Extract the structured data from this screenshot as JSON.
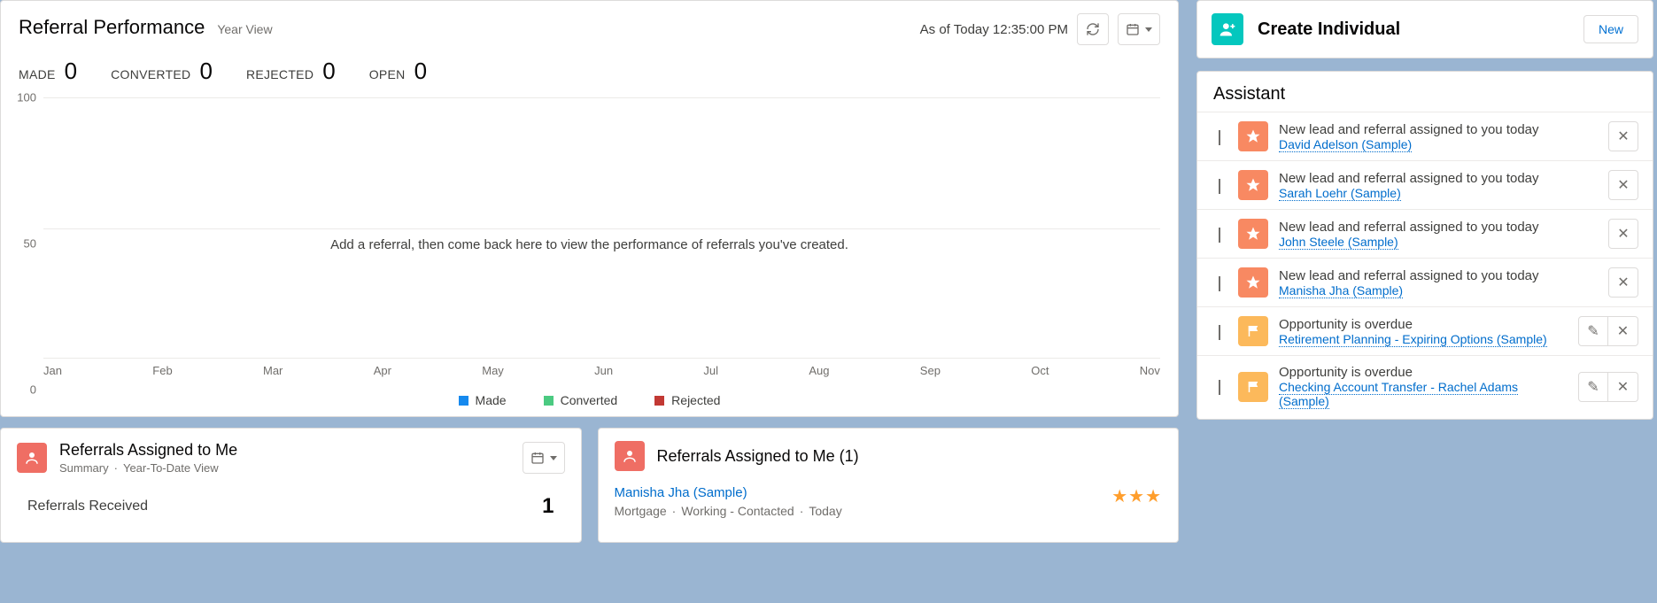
{
  "perf": {
    "title": "Referral Performance",
    "subtitle": "Year View",
    "asof": "As of Today 12:35:00 PM",
    "stats": [
      {
        "label": "MADE",
        "value": "0"
      },
      {
        "label": "CONVERTED",
        "value": "0"
      },
      {
        "label": "REJECTED",
        "value": "0"
      },
      {
        "label": "OPEN",
        "value": "0"
      }
    ],
    "message": "Add a referral, then come back here to view the performance of referrals you've created.",
    "legend": [
      {
        "label": "Made",
        "color": "#1589ee"
      },
      {
        "label": "Converted",
        "color": "#4bca81"
      },
      {
        "label": "Rejected",
        "color": "#c23934"
      }
    ]
  },
  "chart_data": {
    "type": "bar",
    "categories": [
      "Jan",
      "Feb",
      "Mar",
      "Apr",
      "May",
      "Jun",
      "Jul",
      "Aug",
      "Sep",
      "Oct",
      "Nov"
    ],
    "series": [
      {
        "name": "Made",
        "values": [
          0,
          0,
          0,
          0,
          0,
          0,
          0,
          0,
          0,
          0,
          0
        ]
      },
      {
        "name": "Converted",
        "values": [
          0,
          0,
          0,
          0,
          0,
          0,
          0,
          0,
          0,
          0,
          0
        ]
      },
      {
        "name": "Rejected",
        "values": [
          0,
          0,
          0,
          0,
          0,
          0,
          0,
          0,
          0,
          0,
          0
        ]
      }
    ],
    "ylim": [
      0,
      100
    ],
    "yticks": [
      0,
      50,
      100
    ],
    "title": "Referral Performance",
    "xlabel": "",
    "ylabel": ""
  },
  "summary_card": {
    "title": "Referrals Assigned to Me",
    "subtitle_a": "Summary",
    "subtitle_b": "Year-To-Date View",
    "row_label": "Referrals Received",
    "row_value": "1"
  },
  "list_card": {
    "title": "Referrals Assigned to Me (1)",
    "item": {
      "name": "Manisha Jha (Sample)",
      "f1": "Mortgage",
      "f2": "Working - Contacted",
      "f3": "Today",
      "stars": "★★★"
    }
  },
  "create": {
    "title": "Create Individual",
    "button": "New"
  },
  "assistant": {
    "title": "Assistant",
    "lead_msg": "New lead and referral assigned to you today",
    "opp_msg": "Opportunity is overdue",
    "items": [
      {
        "type": "lead",
        "link": "David Adelson (Sample)"
      },
      {
        "type": "lead",
        "link": "Sarah Loehr (Sample)"
      },
      {
        "type": "lead",
        "link": "John Steele (Sample)"
      },
      {
        "type": "lead",
        "link": "Manisha Jha (Sample)"
      },
      {
        "type": "opp",
        "link": "Retirement Planning - Expiring Options (Sample)"
      },
      {
        "type": "opp",
        "link": "Checking Account Transfer - Rachel Adams (Sample)"
      }
    ]
  }
}
